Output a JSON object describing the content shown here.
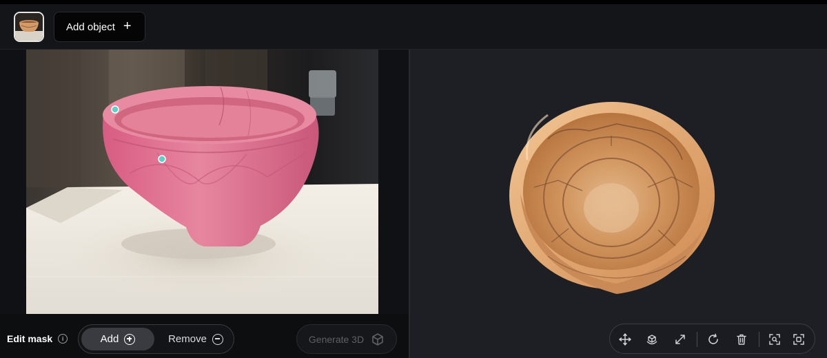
{
  "topbar": {
    "add_object_label": "Add object",
    "add_object_icon": "plus-icon"
  },
  "bottom": {
    "edit_mask_label": "Edit mask",
    "add_label": "Add",
    "remove_label": "Remove",
    "generate_label": "Generate 3D",
    "selected_mode": "Add"
  },
  "toolbar_3d": {
    "icons": [
      "move-icon",
      "rotate-object-icon",
      "scale-icon",
      "reset-icon",
      "delete-icon",
      "focus-icon",
      "fit-view-icon"
    ]
  },
  "colors": {
    "mask_overlay": "#e06a8a",
    "accent_point": "#5fd0c8",
    "pot_orange": "#d7925a",
    "panel_bg": "#1d1f25"
  }
}
